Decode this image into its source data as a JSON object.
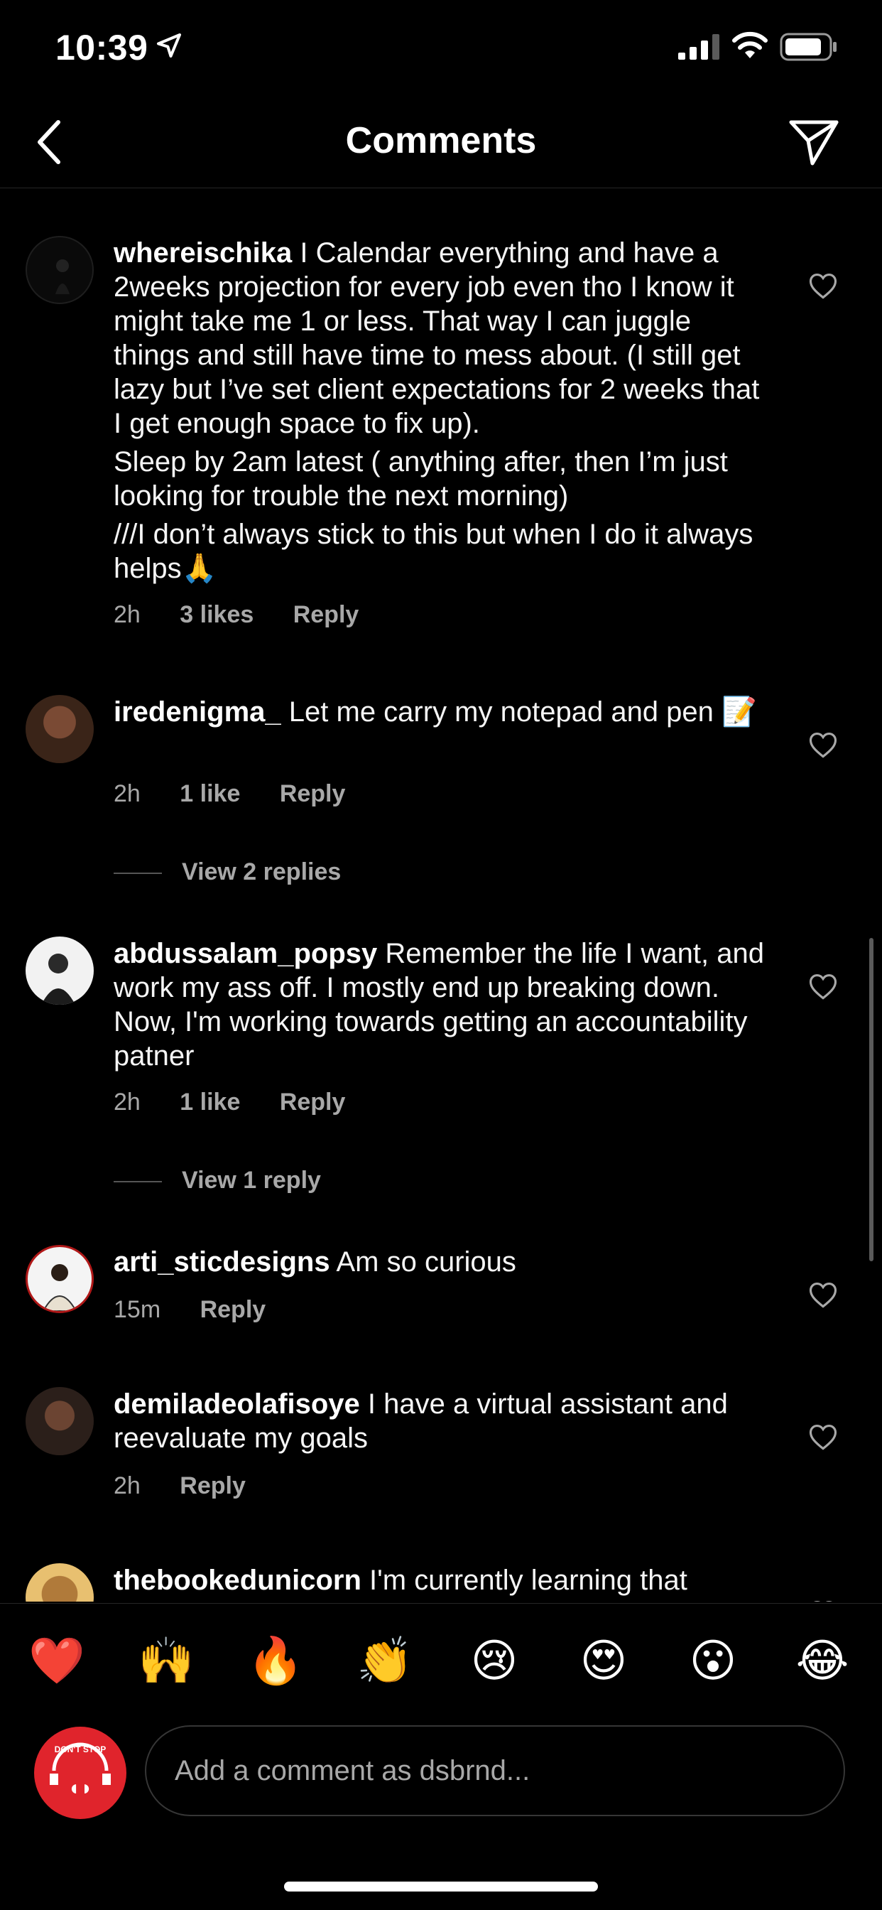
{
  "status_bar": {
    "time": "10:39"
  },
  "header": {
    "title": "Comments"
  },
  "comments": [
    {
      "username": "whereischika",
      "paragraphs": [
        "I Calendar everything and have a 2weeks projection for every job even tho I know it might take me 1 or less. That way I can juggle things and still have time to mess about. (I still get lazy but I’ve set client expectations for 2 weeks that I get enough space to fix up).",
        "Sleep by 2am latest ( anything after, then I’m just looking for trouble the next morning)",
        "///I don’t always stick to this but when I do it always helps🙏"
      ],
      "time": "2h",
      "likes": "3 likes",
      "reply": "Reply"
    },
    {
      "username": "iredenigma_",
      "paragraphs": [
        "Let me carry my notepad and pen"
      ],
      "emoji": "📝",
      "time": "2h",
      "likes": "1 like",
      "reply": "Reply",
      "view_replies": "View 2 replies"
    },
    {
      "username": "abdussalam_popsy",
      "paragraphs": [
        "Remember the life I want, and work my ass off. I mostly end up breaking down. Now, I'm working towards getting an accountability patner"
      ],
      "time": "2h",
      "likes": "1 like",
      "reply": "Reply",
      "view_replies": "View 1 reply"
    },
    {
      "username": "arti_sticdesigns",
      "paragraphs": [
        "Am so curious"
      ],
      "time": "15m",
      "reply": "Reply"
    },
    {
      "username": "demiladeolafisoye",
      "paragraphs": [
        "I have a virtual assistant and reevaluate my goals"
      ],
      "time": "2h",
      "reply": "Reply"
    },
    {
      "username": "thebookedunicorn",
      "paragraphs": [
        "I'm currently learning that"
      ]
    }
  ],
  "reactions": [
    "❤️",
    "🙌",
    "🔥",
    "👏",
    "😢",
    "😍",
    "😮",
    "😂"
  ],
  "composer": {
    "placeholder": "Add a comment as dsbrnd...",
    "avatar_text": "DON'T STOP"
  },
  "colors": {
    "background": "#000000",
    "secondary_text": "#a8a8a8",
    "avatar_red": "#e0242c"
  },
  "icons": [
    "location-arrow-icon",
    "signal-icon",
    "wifi-icon",
    "battery-icon",
    "back-chevron-icon",
    "send-icon",
    "heart-outline-icon"
  ]
}
